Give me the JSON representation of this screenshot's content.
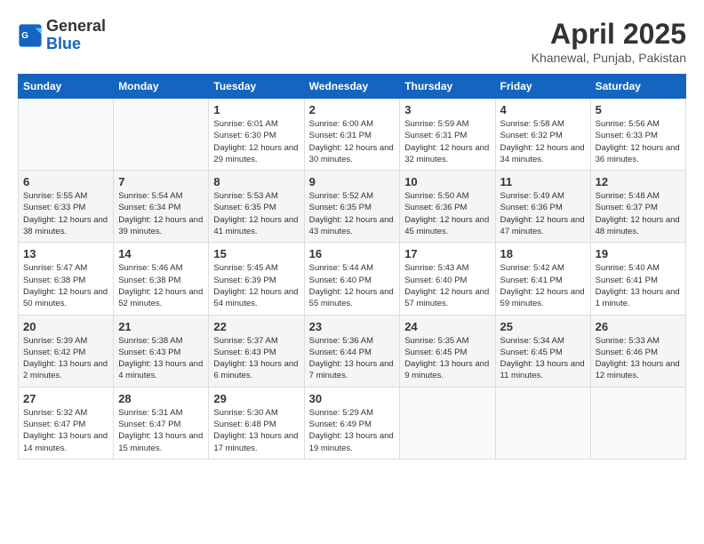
{
  "logo": {
    "line1": "General",
    "line2": "Blue"
  },
  "header": {
    "month": "April 2025",
    "location": "Khanewal, Punjab, Pakistan"
  },
  "columns": [
    "Sunday",
    "Monday",
    "Tuesday",
    "Wednesday",
    "Thursday",
    "Friday",
    "Saturday"
  ],
  "weeks": [
    [
      {
        "day": "",
        "sunrise": "",
        "sunset": "",
        "daylight": ""
      },
      {
        "day": "",
        "sunrise": "",
        "sunset": "",
        "daylight": ""
      },
      {
        "day": "1",
        "sunrise": "Sunrise: 6:01 AM",
        "sunset": "Sunset: 6:30 PM",
        "daylight": "Daylight: 12 hours and 29 minutes."
      },
      {
        "day": "2",
        "sunrise": "Sunrise: 6:00 AM",
        "sunset": "Sunset: 6:31 PM",
        "daylight": "Daylight: 12 hours and 30 minutes."
      },
      {
        "day": "3",
        "sunrise": "Sunrise: 5:59 AM",
        "sunset": "Sunset: 6:31 PM",
        "daylight": "Daylight: 12 hours and 32 minutes."
      },
      {
        "day": "4",
        "sunrise": "Sunrise: 5:58 AM",
        "sunset": "Sunset: 6:32 PM",
        "daylight": "Daylight: 12 hours and 34 minutes."
      },
      {
        "day": "5",
        "sunrise": "Sunrise: 5:56 AM",
        "sunset": "Sunset: 6:33 PM",
        "daylight": "Daylight: 12 hours and 36 minutes."
      }
    ],
    [
      {
        "day": "6",
        "sunrise": "Sunrise: 5:55 AM",
        "sunset": "Sunset: 6:33 PM",
        "daylight": "Daylight: 12 hours and 38 minutes."
      },
      {
        "day": "7",
        "sunrise": "Sunrise: 5:54 AM",
        "sunset": "Sunset: 6:34 PM",
        "daylight": "Daylight: 12 hours and 39 minutes."
      },
      {
        "day": "8",
        "sunrise": "Sunrise: 5:53 AM",
        "sunset": "Sunset: 6:35 PM",
        "daylight": "Daylight: 12 hours and 41 minutes."
      },
      {
        "day": "9",
        "sunrise": "Sunrise: 5:52 AM",
        "sunset": "Sunset: 6:35 PM",
        "daylight": "Daylight: 12 hours and 43 minutes."
      },
      {
        "day": "10",
        "sunrise": "Sunrise: 5:50 AM",
        "sunset": "Sunset: 6:36 PM",
        "daylight": "Daylight: 12 hours and 45 minutes."
      },
      {
        "day": "11",
        "sunrise": "Sunrise: 5:49 AM",
        "sunset": "Sunset: 6:36 PM",
        "daylight": "Daylight: 12 hours and 47 minutes."
      },
      {
        "day": "12",
        "sunrise": "Sunrise: 5:48 AM",
        "sunset": "Sunset: 6:37 PM",
        "daylight": "Daylight: 12 hours and 48 minutes."
      }
    ],
    [
      {
        "day": "13",
        "sunrise": "Sunrise: 5:47 AM",
        "sunset": "Sunset: 6:38 PM",
        "daylight": "Daylight: 12 hours and 50 minutes."
      },
      {
        "day": "14",
        "sunrise": "Sunrise: 5:46 AM",
        "sunset": "Sunset: 6:38 PM",
        "daylight": "Daylight: 12 hours and 52 minutes."
      },
      {
        "day": "15",
        "sunrise": "Sunrise: 5:45 AM",
        "sunset": "Sunset: 6:39 PM",
        "daylight": "Daylight: 12 hours and 54 minutes."
      },
      {
        "day": "16",
        "sunrise": "Sunrise: 5:44 AM",
        "sunset": "Sunset: 6:40 PM",
        "daylight": "Daylight: 12 hours and 55 minutes."
      },
      {
        "day": "17",
        "sunrise": "Sunrise: 5:43 AM",
        "sunset": "Sunset: 6:40 PM",
        "daylight": "Daylight: 12 hours and 57 minutes."
      },
      {
        "day": "18",
        "sunrise": "Sunrise: 5:42 AM",
        "sunset": "Sunset: 6:41 PM",
        "daylight": "Daylight: 12 hours and 59 minutes."
      },
      {
        "day": "19",
        "sunrise": "Sunrise: 5:40 AM",
        "sunset": "Sunset: 6:41 PM",
        "daylight": "Daylight: 13 hours and 1 minute."
      }
    ],
    [
      {
        "day": "20",
        "sunrise": "Sunrise: 5:39 AM",
        "sunset": "Sunset: 6:42 PM",
        "daylight": "Daylight: 13 hours and 2 minutes."
      },
      {
        "day": "21",
        "sunrise": "Sunrise: 5:38 AM",
        "sunset": "Sunset: 6:43 PM",
        "daylight": "Daylight: 13 hours and 4 minutes."
      },
      {
        "day": "22",
        "sunrise": "Sunrise: 5:37 AM",
        "sunset": "Sunset: 6:43 PM",
        "daylight": "Daylight: 13 hours and 6 minutes."
      },
      {
        "day": "23",
        "sunrise": "Sunrise: 5:36 AM",
        "sunset": "Sunset: 6:44 PM",
        "daylight": "Daylight: 13 hours and 7 minutes."
      },
      {
        "day": "24",
        "sunrise": "Sunrise: 5:35 AM",
        "sunset": "Sunset: 6:45 PM",
        "daylight": "Daylight: 13 hours and 9 minutes."
      },
      {
        "day": "25",
        "sunrise": "Sunrise: 5:34 AM",
        "sunset": "Sunset: 6:45 PM",
        "daylight": "Daylight: 13 hours and 11 minutes."
      },
      {
        "day": "26",
        "sunrise": "Sunrise: 5:33 AM",
        "sunset": "Sunset: 6:46 PM",
        "daylight": "Daylight: 13 hours and 12 minutes."
      }
    ],
    [
      {
        "day": "27",
        "sunrise": "Sunrise: 5:32 AM",
        "sunset": "Sunset: 6:47 PM",
        "daylight": "Daylight: 13 hours and 14 minutes."
      },
      {
        "day": "28",
        "sunrise": "Sunrise: 5:31 AM",
        "sunset": "Sunset: 6:47 PM",
        "daylight": "Daylight: 13 hours and 15 minutes."
      },
      {
        "day": "29",
        "sunrise": "Sunrise: 5:30 AM",
        "sunset": "Sunset: 6:48 PM",
        "daylight": "Daylight: 13 hours and 17 minutes."
      },
      {
        "day": "30",
        "sunrise": "Sunrise: 5:29 AM",
        "sunset": "Sunset: 6:49 PM",
        "daylight": "Daylight: 13 hours and 19 minutes."
      },
      {
        "day": "",
        "sunrise": "",
        "sunset": "",
        "daylight": ""
      },
      {
        "day": "",
        "sunrise": "",
        "sunset": "",
        "daylight": ""
      },
      {
        "day": "",
        "sunrise": "",
        "sunset": "",
        "daylight": ""
      }
    ]
  ]
}
